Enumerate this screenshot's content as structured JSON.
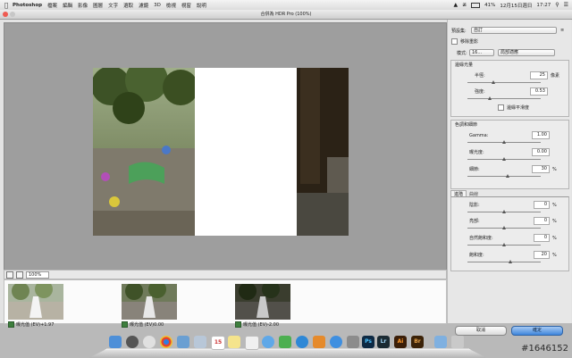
{
  "menubar": {
    "app_name": "Photoshop",
    "items": [
      "檔案",
      "編輯",
      "影像",
      "圖層",
      "文字",
      "選取",
      "濾鏡",
      "3D",
      "檢視",
      "視窗",
      "說明"
    ],
    "battery": "41%",
    "date": "12月15日週日",
    "time": "17:27"
  },
  "window": {
    "title": "合併為 HDR Pro (100%)"
  },
  "status": {
    "zoom": "100%"
  },
  "filmstrip": [
    {
      "label": "曝光值 (EV)+1.97",
      "checked": true
    },
    {
      "label": "曝光值 (EV)0.00",
      "checked": true
    },
    {
      "label": "曝光值 (EV)-2.00",
      "checked": true
    }
  ],
  "panel": {
    "preset_label": "預設集:",
    "preset_value": "自訂",
    "remove_ghosts": "移除重影",
    "mode_label": "模式:",
    "mode_bits": "16...",
    "mode_method": "局部適應",
    "edge_glow": {
      "title": "邊緣光量",
      "radius_label": "半徑:",
      "radius_value": "25",
      "radius_unit": "像素",
      "radius_level": 0.35,
      "strength_label": "強度:",
      "strength_value": "0.53",
      "strength_level": 0.3,
      "smooth_edges": "邊緣平滑度"
    },
    "tone_detail": {
      "title": "色調和細節",
      "gamma_label": "Gamma:",
      "gamma_value": "1.00",
      "gamma_level": 0.5,
      "exposure_label": "曝光度:",
      "exposure_value": "0.00",
      "exposure_level": 0.5,
      "detail_label": "細節:",
      "detail_value": "30",
      "detail_unit": "%",
      "detail_level": 0.55
    },
    "tabs": [
      "進階",
      "曲線"
    ],
    "advanced": {
      "shadow_label": "陰影:",
      "shadow_value": "0",
      "highlight_label": "亮部:",
      "highlight_value": "0",
      "vibrance_label": "自然飽和度:",
      "vibrance_value": "0",
      "saturation_label": "飽和度:",
      "saturation_value": "20",
      "unit": "%",
      "shadow_level": 0.5,
      "highlight_level": 0.5,
      "vibrance_level": 0.5,
      "saturation_level": 0.58
    },
    "cancel": "取消",
    "ok": "確定"
  },
  "dock": {
    "apps": [
      "Finder",
      "Launchpad",
      "Chrome",
      "Preview",
      "Mail",
      "Calendar",
      "Notes",
      "Reminders",
      "Photos",
      "Messages",
      "FaceTime",
      "iTunes",
      "iBooks",
      "App Store",
      "System Preferences",
      "Photoshop",
      "Lightroom",
      "Illustrator",
      "Bridge",
      "Documents",
      "Trash"
    ],
    "calendar_day": "15",
    "ps_label": "Ps",
    "lr_label": "Lr",
    "ai_label": "Ai",
    "br_label": "Br"
  },
  "watermark": "#1646152",
  "colors": {
    "accent": "#3f86dc",
    "checkbox": "#3d7e3d"
  }
}
